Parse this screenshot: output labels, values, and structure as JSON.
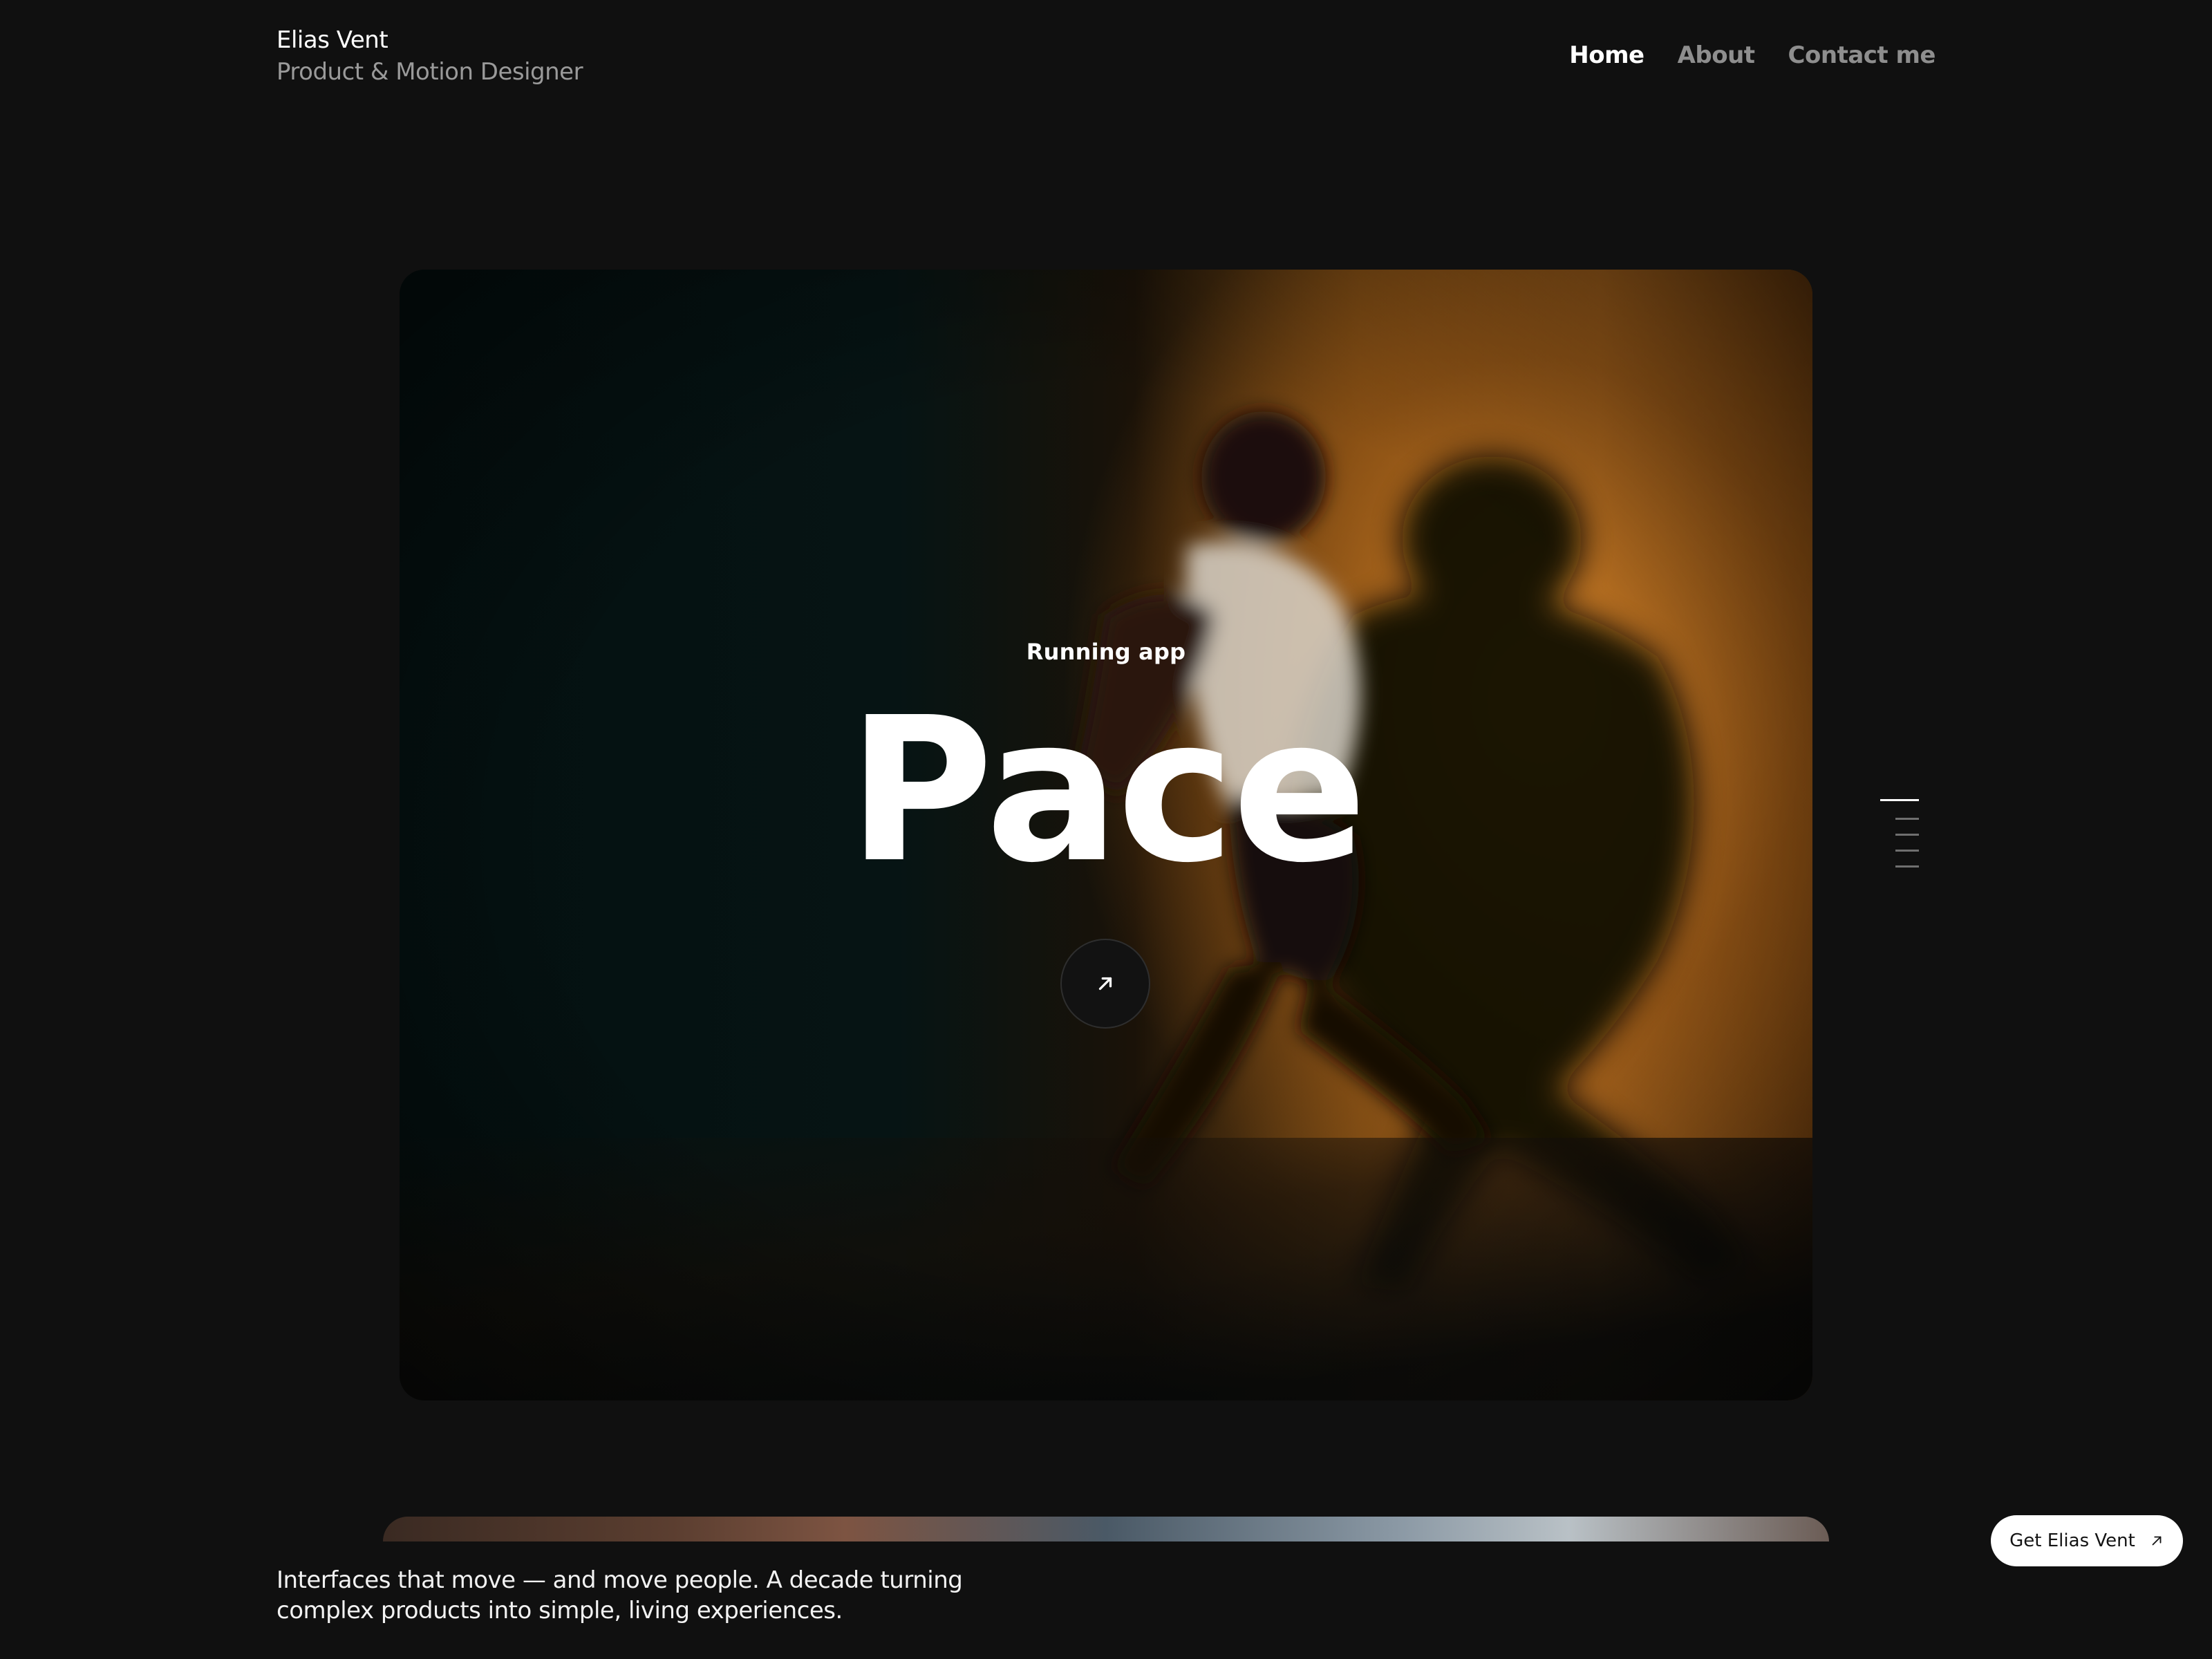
{
  "header": {
    "name": "Elias Vent",
    "role": "Product & Motion Designer",
    "nav": [
      {
        "label": "Home",
        "active": true
      },
      {
        "label": "About",
        "active": false
      },
      {
        "label": "Contact me",
        "active": false
      }
    ]
  },
  "hero": {
    "kicker": "Running app",
    "title": "Pace",
    "open_icon": "arrow-up-right-icon"
  },
  "pager": {
    "count": 5,
    "active_index": 0
  },
  "footer": {
    "tagline": "Interfaces that move — and move people. A decade turning complex products into simple, living experiences."
  },
  "cta": {
    "label": "Get Elias Vent",
    "icon": "arrow-up-right-icon"
  },
  "colors": {
    "background": "#101010",
    "accent_warm": "#a8661f",
    "text_primary": "#ffffff",
    "text_muted": "#9a9a9a"
  }
}
